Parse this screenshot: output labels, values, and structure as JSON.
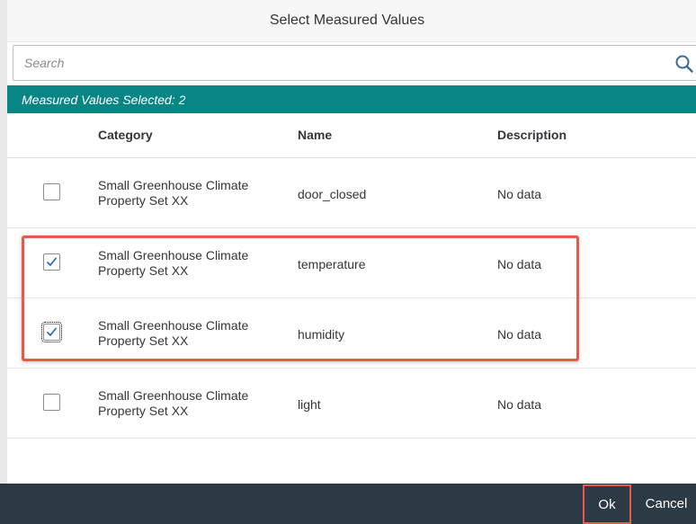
{
  "dialog": {
    "title": "Select Measured Values"
  },
  "search": {
    "placeholder": "Search",
    "value": "",
    "icon": "search-icon"
  },
  "info_bar": {
    "text": "Measured Values Selected: 2",
    "color": "#0a8585"
  },
  "table": {
    "columns": [
      "Category",
      "Name",
      "Description"
    ],
    "rows": [
      {
        "checked": false,
        "category": "Small Greenhouse Climate Property Set XX",
        "name": "door_closed",
        "description": "No data"
      },
      {
        "checked": true,
        "category": "Small Greenhouse Climate Property Set XX",
        "name": "temperature",
        "description": "No data"
      },
      {
        "checked": true,
        "category": "Small Greenhouse Climate Property Set XX",
        "name": "humidity",
        "description": "No data"
      },
      {
        "checked": false,
        "category": "Small Greenhouse Climate Property Set XX",
        "name": "light",
        "description": "No data"
      }
    ]
  },
  "footer": {
    "ok_label": "Ok",
    "cancel_label": "Cancel",
    "background": "#2c3a45"
  },
  "annotation": {
    "highlight_color": "#e8594a"
  }
}
